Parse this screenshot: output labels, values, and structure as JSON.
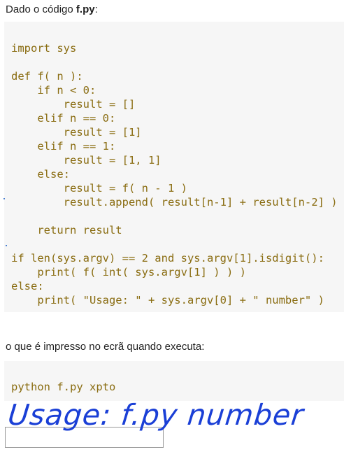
{
  "intro": {
    "prefix": "Dado o código ",
    "filename": "f.py",
    "suffix": ":"
  },
  "code": {
    "lines": [
      "import sys",
      "",
      "def f( n ):",
      "    if n < 0:",
      "        result = []",
      "    elif n == 0:",
      "        result = [1]",
      "    elif n == 1:",
      "        result = [1, 1]",
      "    else:",
      "        result = f( n - 1 )",
      "        result.append( result[n-1] + result[n-2] )",
      "",
      "    return result",
      "",
      "if len(sys.argv) == 2 and sys.argv[1].isdigit():",
      "    print( f( int( sys.argv[1] ) ) )",
      "else:",
      "    print( \"Usage: \" + sys.argv[0] + \" number\" )"
    ]
  },
  "question": "o que é impresso no ecrã quando executa:",
  "command": "python f.py xpto",
  "answer": {
    "handwritten": "Usage: f.py number",
    "input_value": ""
  },
  "colors": {
    "code_text": "#8a6d12",
    "code_bg": "#f6f6f6",
    "handwriting": "#1a3fd6"
  }
}
